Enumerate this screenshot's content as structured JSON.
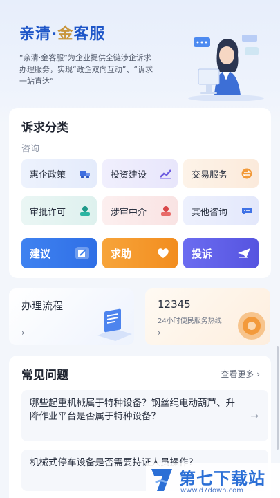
{
  "hero": {
    "title_blue": "亲清·",
    "title_gold": "金",
    "title_rest": "客服",
    "desc": "“亲清·金客服”为企业提供全链涉企诉求办理服务，实现“政企双向互动”、“诉求一站直达”"
  },
  "categories": {
    "title": "诉求分类",
    "sub_label": "咨询",
    "tiles": [
      {
        "label": "惠企政策",
        "icon": "truck-icon"
      },
      {
        "label": "投资建设",
        "icon": "chart-icon"
      },
      {
        "label": "交易服务",
        "icon": "exchange-icon"
      },
      {
        "label": "审批许可",
        "icon": "person-icon"
      },
      {
        "label": "涉审中介",
        "icon": "agent-icon"
      },
      {
        "label": "其他咨询",
        "icon": "chat-icon"
      }
    ],
    "actions": [
      {
        "label": "建议",
        "icon": "edit-icon"
      },
      {
        "label": "求助",
        "icon": "heart-hand-icon"
      },
      {
        "label": "投诉",
        "icon": "send-icon"
      }
    ]
  },
  "process": {
    "title": "办理流程",
    "arrow": "›"
  },
  "hotline": {
    "number": "12345",
    "sub": "24小时便民服务热线",
    "arrow": "›"
  },
  "faq": {
    "title": "常见问题",
    "more": "查看更多 ›",
    "items": [
      {
        "q": "哪些起重机械属于特种设备？钢丝绳电动葫芦、升降作业平台是否属于特种设备？"
      },
      {
        "q": "机械式停车设备是否需要持证人员操作？"
      }
    ]
  },
  "watermark": {
    "text": "第七下载站",
    "url": "www.d7down.com"
  },
  "colors": {
    "primary": "#2f6fe6",
    "gold": "#c8963e",
    "orange": "#f28d1f",
    "purple": "#5654e0"
  }
}
